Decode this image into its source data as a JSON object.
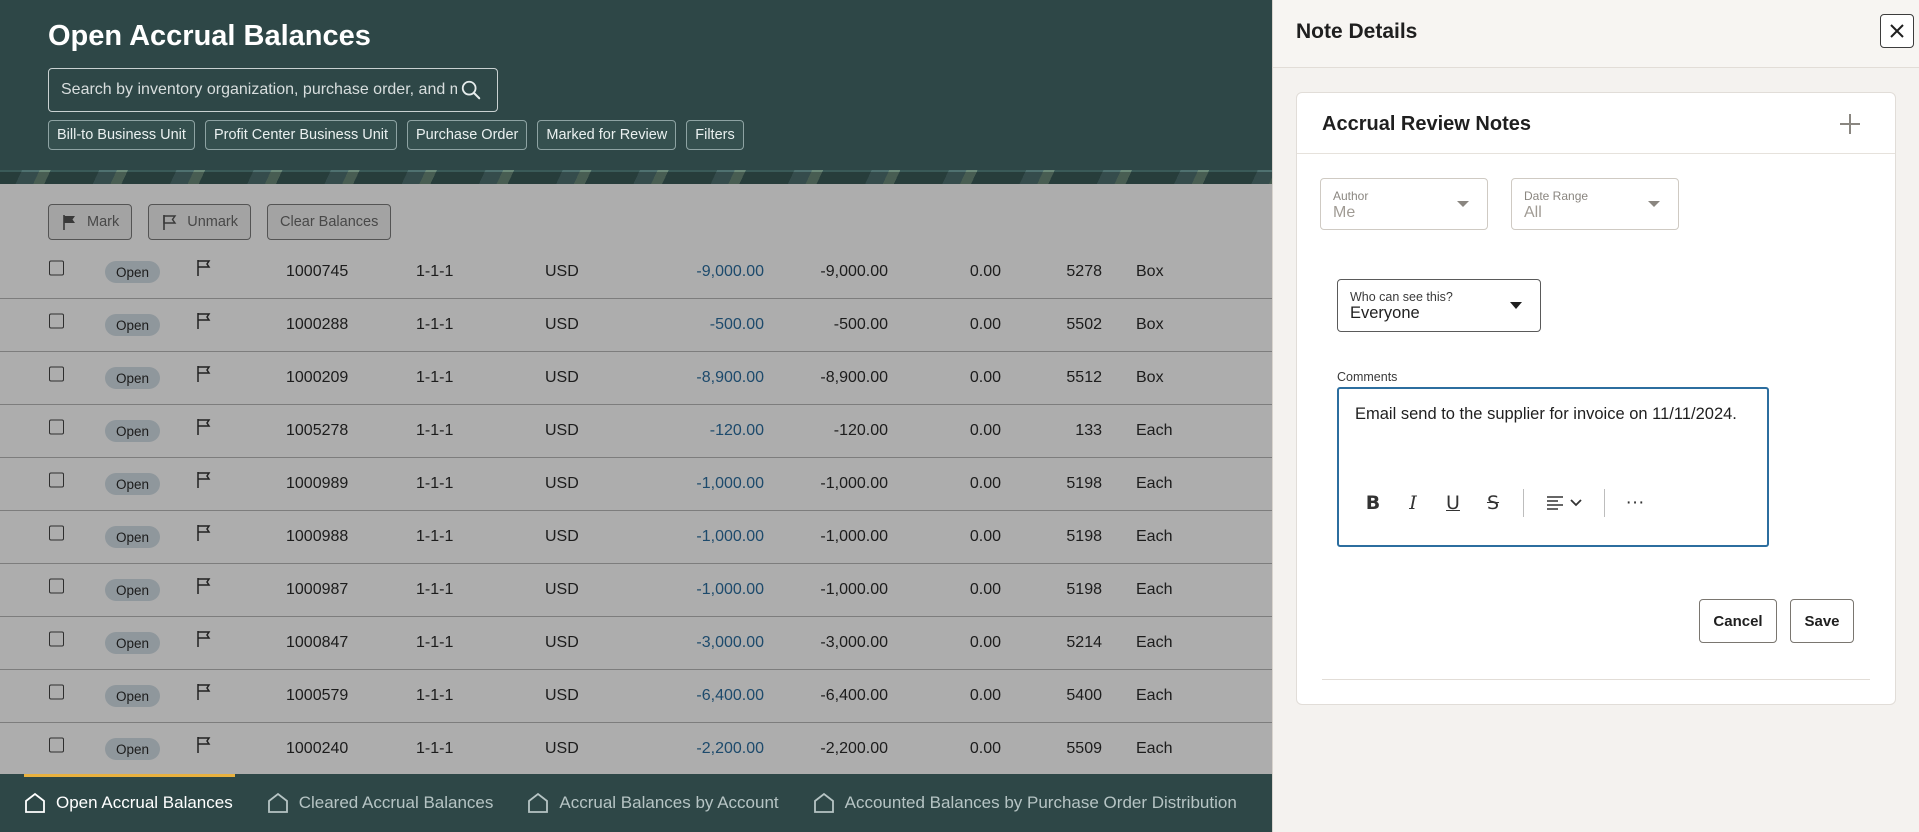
{
  "header": {
    "title": "Open Accrual Balances",
    "search_placeholder": "Search by inventory organization, purchase order, and more",
    "chips": [
      "Bill-to Business Unit",
      "Profit Center Business Unit",
      "Purchase Order",
      "Marked for Review",
      "Filters"
    ]
  },
  "toolbar": {
    "mark_label": "Mark",
    "unmark_label": "Unmark",
    "clear_label": "Clear Balances"
  },
  "rows": [
    {
      "status": "Open",
      "number": "1000745",
      "code": "1-1-1",
      "currency": "USD",
      "amount": "-9,000.00",
      "balance": "-9,000.00",
      "zero": "0.00",
      "qty": "5278",
      "uom": "Box"
    },
    {
      "status": "Open",
      "number": "1000288",
      "code": "1-1-1",
      "currency": "USD",
      "amount": "-500.00",
      "balance": "-500.00",
      "zero": "0.00",
      "qty": "5502",
      "uom": "Box"
    },
    {
      "status": "Open",
      "number": "1000209",
      "code": "1-1-1",
      "currency": "USD",
      "amount": "-8,900.00",
      "balance": "-8,900.00",
      "zero": "0.00",
      "qty": "5512",
      "uom": "Box"
    },
    {
      "status": "Open",
      "number": "1005278",
      "code": "1-1-1",
      "currency": "USD",
      "amount": "-120.00",
      "balance": "-120.00",
      "zero": "0.00",
      "qty": "133",
      "uom": "Each"
    },
    {
      "status": "Open",
      "number": "1000989",
      "code": "1-1-1",
      "currency": "USD",
      "amount": "-1,000.00",
      "balance": "-1,000.00",
      "zero": "0.00",
      "qty": "5198",
      "uom": "Each"
    },
    {
      "status": "Open",
      "number": "1000988",
      "code": "1-1-1",
      "currency": "USD",
      "amount": "-1,000.00",
      "balance": "-1,000.00",
      "zero": "0.00",
      "qty": "5198",
      "uom": "Each"
    },
    {
      "status": "Open",
      "number": "1000987",
      "code": "1-1-1",
      "currency": "USD",
      "amount": "-1,000.00",
      "balance": "-1,000.00",
      "zero": "0.00",
      "qty": "5198",
      "uom": "Each"
    },
    {
      "status": "Open",
      "number": "1000847",
      "code": "1-1-1",
      "currency": "USD",
      "amount": "-3,000.00",
      "balance": "-3,000.00",
      "zero": "0.00",
      "qty": "5214",
      "uom": "Each"
    },
    {
      "status": "Open",
      "number": "1000579",
      "code": "1-1-1",
      "currency": "USD",
      "amount": "-6,400.00",
      "balance": "-6,400.00",
      "zero": "0.00",
      "qty": "5400",
      "uom": "Each"
    },
    {
      "status": "Open",
      "number": "1000240",
      "code": "1-1-1",
      "currency": "USD",
      "amount": "-2,200.00",
      "balance": "-2,200.00",
      "zero": "0.00",
      "qty": "5509",
      "uom": "Each"
    }
  ],
  "bottom_nav": [
    {
      "label": "Open Accrual Balances",
      "active": true
    },
    {
      "label": "Cleared Accrual Balances",
      "active": false
    },
    {
      "label": "Accrual Balances by Account",
      "active": false
    },
    {
      "label": "Accounted Balances by Purchase Order Distribution",
      "active": false
    }
  ],
  "drawer": {
    "title": "Note Details",
    "card_title": "Accrual Review Notes",
    "author": {
      "label": "Author",
      "value": "Me"
    },
    "date_range": {
      "label": "Date Range",
      "value": "All"
    },
    "visibility": {
      "label": "Who can see this?",
      "value": "Everyone"
    },
    "comments_label": "Comments",
    "comment_text": "Email send to the supplier for invoice on 11/11/2024.",
    "cancel_label": "Cancel",
    "save_label": "Save",
    "editor_tools": {
      "bold": "B",
      "italic": "I",
      "underline": "U",
      "strike": "S",
      "more": "···"
    }
  },
  "colors": {
    "header_bg": "#2e4747",
    "link_blue": "#2c6e9f",
    "active_tab_accent": "#e8b13f"
  }
}
